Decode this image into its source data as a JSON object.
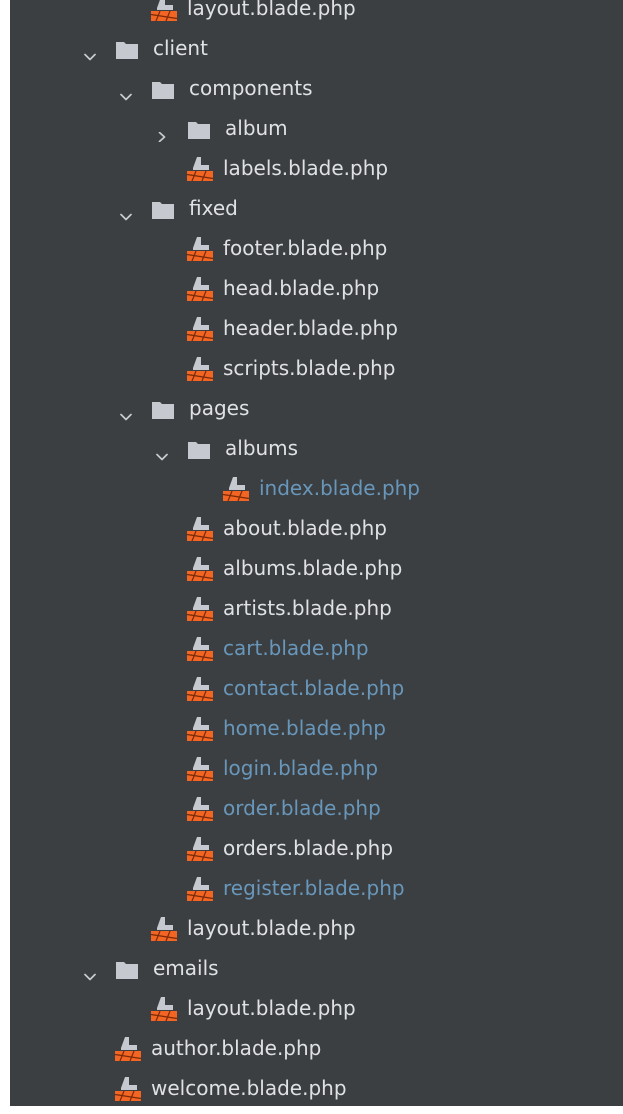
{
  "colors": {
    "panel_bg": "#3c3f41",
    "text_default": "#dfe1e5",
    "text_modified": "#6897bb",
    "folder_icon": "#c6cad0",
    "blade_icon": "#f26522"
  },
  "tree": [
    {
      "name": "layout.blade.php",
      "type": "file",
      "depth": 1,
      "status": "normal"
    },
    {
      "name": "client",
      "type": "folder",
      "depth": 0,
      "expanded": true
    },
    {
      "name": "components",
      "type": "folder",
      "depth": 1,
      "expanded": true
    },
    {
      "name": "album",
      "type": "folder",
      "depth": 2,
      "expanded": false
    },
    {
      "name": "labels.blade.php",
      "type": "file",
      "depth": 2,
      "status": "normal"
    },
    {
      "name": "fixed",
      "type": "folder",
      "depth": 1,
      "expanded": true
    },
    {
      "name": "footer.blade.php",
      "type": "file",
      "depth": 2,
      "status": "normal"
    },
    {
      "name": "head.blade.php",
      "type": "file",
      "depth": 2,
      "status": "normal"
    },
    {
      "name": "header.blade.php",
      "type": "file",
      "depth": 2,
      "status": "normal"
    },
    {
      "name": "scripts.blade.php",
      "type": "file",
      "depth": 2,
      "status": "normal"
    },
    {
      "name": "pages",
      "type": "folder",
      "depth": 1,
      "expanded": true
    },
    {
      "name": "albums",
      "type": "folder",
      "depth": 2,
      "expanded": true
    },
    {
      "name": "index.blade.php",
      "type": "file",
      "depth": 3,
      "status": "modified"
    },
    {
      "name": "about.blade.php",
      "type": "file",
      "depth": 2,
      "status": "normal"
    },
    {
      "name": "albums.blade.php",
      "type": "file",
      "depth": 2,
      "status": "normal"
    },
    {
      "name": "artists.blade.php",
      "type": "file",
      "depth": 2,
      "status": "normal"
    },
    {
      "name": "cart.blade.php",
      "type": "file",
      "depth": 2,
      "status": "modified"
    },
    {
      "name": "contact.blade.php",
      "type": "file",
      "depth": 2,
      "status": "modified"
    },
    {
      "name": "home.blade.php",
      "type": "file",
      "depth": 2,
      "status": "modified"
    },
    {
      "name": "login.blade.php",
      "type": "file",
      "depth": 2,
      "status": "modified"
    },
    {
      "name": "order.blade.php",
      "type": "file",
      "depth": 2,
      "status": "modified"
    },
    {
      "name": "orders.blade.php",
      "type": "file",
      "depth": 2,
      "status": "normal"
    },
    {
      "name": "register.blade.php",
      "type": "file",
      "depth": 2,
      "status": "modified"
    },
    {
      "name": "layout.blade.php",
      "type": "file",
      "depth": 1,
      "status": "normal"
    },
    {
      "name": "emails",
      "type": "folder",
      "depth": 0,
      "expanded": true
    },
    {
      "name": "layout.blade.php",
      "type": "file",
      "depth": 1,
      "status": "normal"
    },
    {
      "name": "author.blade.php",
      "type": "file",
      "depth": 0,
      "status": "normal"
    },
    {
      "name": "welcome.blade.php",
      "type": "file",
      "depth": 0,
      "status": "normal"
    }
  ]
}
